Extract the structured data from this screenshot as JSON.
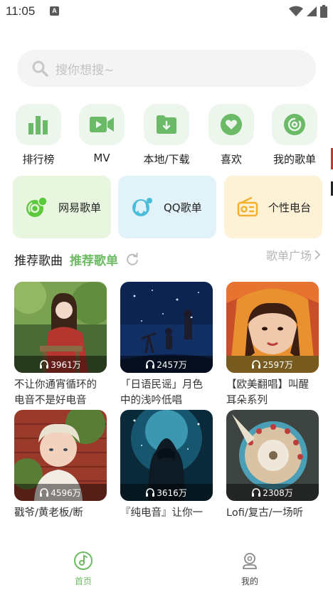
{
  "status_bar": {
    "time": "11:05",
    "notification_letter": "A"
  },
  "search": {
    "placeholder": "搜你想搜~"
  },
  "quick_actions": [
    {
      "label": "排行榜",
      "icon": "chart-bars-icon"
    },
    {
      "label": "MV",
      "icon": "video-camera-icon"
    },
    {
      "label": "本地/下载",
      "icon": "folder-download-icon"
    },
    {
      "label": "喜欢",
      "icon": "heart-icon"
    },
    {
      "label": "我的歌单",
      "icon": "playlist-disc-icon"
    }
  ],
  "sources": [
    {
      "label": "网易歌单",
      "icon": "netease-logo-icon",
      "bg": "#e8f6df"
    },
    {
      "label": "QQ歌单",
      "icon": "qq-penguin-icon",
      "bg": "#e1f2f9"
    },
    {
      "label": "个性电台",
      "icon": "radio-icon",
      "bg": "#fdf1d6"
    }
  ],
  "section": {
    "tab_inactive": "推荐歌曲",
    "tab_active": "推荐歌单",
    "more_label": "歌单广场"
  },
  "playlists": [
    {
      "plays": "3961万",
      "title": "不让你通宵循环的电音不是好电音"
    },
    {
      "plays": "2457万",
      "title": "「日语民谣」月色中的浅吟低唱"
    },
    {
      "plays": "2597万",
      "title": "【欧美翻唱】叫醒耳朵系列"
    },
    {
      "plays": "4596万",
      "title": "戳爷/黄老板/断"
    },
    {
      "plays": "3616万",
      "title": "『纯电音』让你一"
    },
    {
      "plays": "2308万",
      "title": "Lofi/复古/一场听"
    }
  ],
  "tabbar": {
    "home": "首页",
    "mine": "我的"
  },
  "colors": {
    "accent": "#6dbb63",
    "icon_green": "#6aba68"
  }
}
